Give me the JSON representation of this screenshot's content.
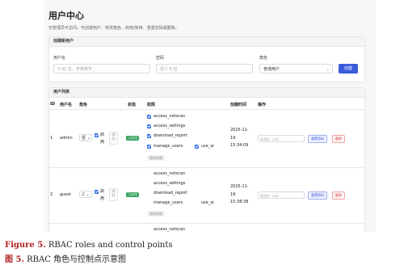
{
  "page": {
    "title": "用户中心",
    "subtitle": "仅管理员可访问。可创建用户、修改角色、启用/禁用、重置密码或删除。"
  },
  "create_form": {
    "header": "创建新用户",
    "username_label": "用户名",
    "username_placeholder": "3-32 位，字母数字_-",
    "password_label": "密码",
    "password_placeholder": "至少 6 位",
    "role_label": "角色",
    "role_value": "普通用户",
    "create_button": "创建"
  },
  "user_list": {
    "header": "用户列表",
    "columns": [
      "ID",
      "用户名",
      "角色",
      "状态",
      "权限",
      "创建时间",
      "操作"
    ],
    "rows": [
      {
        "id": "1",
        "username": "admin",
        "role_short": "竖",
        "enabled_label": "启",
        "enabled_label2": "用",
        "save_label1": "保",
        "save_label2": "存",
        "status": "已启用",
        "permissions": [
          {
            "name": "access_netscan",
            "checked": true
          },
          {
            "name": "access_settings",
            "checked": true
          },
          {
            "name": "download_report",
            "checked": true
          },
          {
            "name": "manage_users",
            "checked": true
          },
          {
            "name": "use_ai",
            "checked": true
          }
        ],
        "save_perms": "保存权限",
        "created_date": "2025-11-",
        "created_day": "19",
        "created_time": "15:34:09",
        "new_password_placeholder": "新密码（≥6）",
        "reset_button": "重置密码",
        "delete_button": "删除"
      },
      {
        "id": "2",
        "username": "guest",
        "role_short": "ℤ",
        "enabled_label": "启",
        "enabled_label2": "用",
        "save_label1": "保",
        "save_label2": "存",
        "status": "已启用",
        "permissions": [
          {
            "name": "access_netscan",
            "checked": false
          },
          {
            "name": "access_settings",
            "checked": false
          },
          {
            "name": "download_report",
            "checked": false
          },
          {
            "name": "manage_users",
            "checked": false
          },
          {
            "name": "use_ai",
            "checked": false
          }
        ],
        "save_perms": "保存权限",
        "created_date": "2025-11-",
        "created_day": "19",
        "created_time": "15:38:38",
        "new_password_placeholder": "新密码（≥6）",
        "reset_button": "重置密码",
        "delete_button": "删除"
      },
      {
        "permissions_partial": "access_netscan"
      }
    ]
  },
  "caption": {
    "en_label": "Figure 5.",
    "en_text": " RBAC roles and control points",
    "zh_label": "图 5.",
    "zh_text": " RBAC 角色与控制点示意图"
  },
  "colors": {
    "primary": "#3b5bdb",
    "checkbox": "#2f6fe4",
    "status_green": "#2e9e5b",
    "delete_red": "#d64545",
    "caption_red": "#b22222"
  }
}
